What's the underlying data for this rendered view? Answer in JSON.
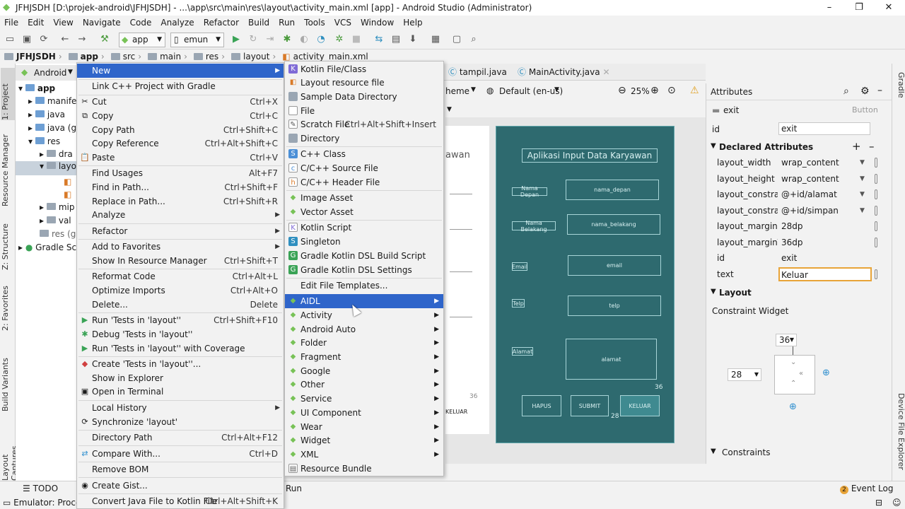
{
  "window": {
    "title": "JFHJSDH [D:\\projek-android\\JFHJSDH] - ...\\app\\src\\main\\res\\layout\\activity_main.xml [app] - Android Studio (Administrator)"
  },
  "menubar": [
    "File",
    "Edit",
    "View",
    "Navigate",
    "Code",
    "Analyze",
    "Refactor",
    "Build",
    "Run",
    "Tools",
    "VCS",
    "Window",
    "Help"
  ],
  "toolbar": {
    "run_config": "app",
    "device": "emun"
  },
  "breadcrumb": [
    "JFHJSDH",
    "app",
    "src",
    "main",
    "res",
    "layout",
    "activity_main.xml"
  ],
  "project": {
    "view": "Android",
    "items": [
      "app",
      "manife",
      "java",
      "java (g",
      "res",
      "dra",
      "layo",
      "mip",
      "val",
      "res (ge",
      "Gradle Scr"
    ]
  },
  "left_tabs": [
    "1: Project",
    "Resource Manager",
    "Z: Structure",
    "2: Favorites",
    "Build Variants",
    "Layout Captures"
  ],
  "context_menu": [
    {
      "label": "New",
      "shortcut": "",
      "submenu": true
    },
    {
      "label": "Link C++ Project with Gradle",
      "shortcut": ""
    },
    {
      "label": "Cut",
      "shortcut": "Ctrl+X"
    },
    {
      "label": "Copy",
      "shortcut": "Ctrl+C"
    },
    {
      "label": "Copy Path",
      "shortcut": "Ctrl+Shift+C"
    },
    {
      "label": "Copy Reference",
      "shortcut": "Ctrl+Alt+Shift+C"
    },
    {
      "label": "Paste",
      "shortcut": "Ctrl+V"
    },
    {
      "label": "Find Usages",
      "shortcut": "Alt+F7"
    },
    {
      "label": "Find in Path...",
      "shortcut": "Ctrl+Shift+F"
    },
    {
      "label": "Replace in Path...",
      "shortcut": "Ctrl+Shift+R"
    },
    {
      "label": "Analyze",
      "shortcut": "",
      "submenu": true
    },
    {
      "label": "Refactor",
      "shortcut": "",
      "submenu": true
    },
    {
      "label": "Add to Favorites",
      "shortcut": "",
      "submenu": true
    },
    {
      "label": "Show In Resource Manager",
      "shortcut": "Ctrl+Shift+T"
    },
    {
      "label": "Reformat Code",
      "shortcut": "Ctrl+Alt+L"
    },
    {
      "label": "Optimize Imports",
      "shortcut": "Ctrl+Alt+O"
    },
    {
      "label": "Delete...",
      "shortcut": "Delete"
    },
    {
      "label": "Run 'Tests in 'layout''",
      "shortcut": "Ctrl+Shift+F10"
    },
    {
      "label": "Debug 'Tests in 'layout''",
      "shortcut": ""
    },
    {
      "label": "Run 'Tests in 'layout'' with Coverage",
      "shortcut": ""
    },
    {
      "label": "Create 'Tests in 'layout''...",
      "shortcut": ""
    },
    {
      "label": "Show in Explorer",
      "shortcut": ""
    },
    {
      "label": "Open in Terminal",
      "shortcut": ""
    },
    {
      "label": "Local History",
      "shortcut": "",
      "submenu": true
    },
    {
      "label": "Synchronize 'layout'",
      "shortcut": ""
    },
    {
      "label": "Directory Path",
      "shortcut": "Ctrl+Alt+F12"
    },
    {
      "label": "Compare With...",
      "shortcut": "Ctrl+D"
    },
    {
      "label": "Remove BOM",
      "shortcut": ""
    },
    {
      "label": "Create Gist...",
      "shortcut": ""
    },
    {
      "label": "Convert Java File to Kotlin File",
      "shortcut": "Ctrl+Alt+Shift+K"
    }
  ],
  "new_submenu": [
    {
      "label": "Kotlin File/Class",
      "shortcut": ""
    },
    {
      "label": "Layout resource file",
      "shortcut": ""
    },
    {
      "label": "Sample Data Directory",
      "shortcut": ""
    },
    {
      "label": "File",
      "shortcut": ""
    },
    {
      "label": "Scratch File",
      "shortcut": "Ctrl+Alt+Shift+Insert"
    },
    {
      "label": "Directory",
      "shortcut": ""
    },
    {
      "label": "C++ Class",
      "shortcut": ""
    },
    {
      "label": "C/C++ Source File",
      "shortcut": ""
    },
    {
      "label": "C/C++ Header File",
      "shortcut": ""
    },
    {
      "label": "Image Asset",
      "shortcut": ""
    },
    {
      "label": "Vector Asset",
      "shortcut": ""
    },
    {
      "label": "Kotlin Script",
      "shortcut": ""
    },
    {
      "label": "Singleton",
      "shortcut": ""
    },
    {
      "label": "Gradle Kotlin DSL Build Script",
      "shortcut": ""
    },
    {
      "label": "Gradle Kotlin DSL Settings",
      "shortcut": ""
    },
    {
      "label": "Edit File Templates...",
      "shortcut": ""
    },
    {
      "label": "AIDL",
      "shortcut": "",
      "submenu": true
    },
    {
      "label": "Activity",
      "shortcut": "",
      "submenu": true
    },
    {
      "label": "Android Auto",
      "shortcut": "",
      "submenu": true
    },
    {
      "label": "Folder",
      "shortcut": "",
      "submenu": true
    },
    {
      "label": "Fragment",
      "shortcut": "",
      "submenu": true
    },
    {
      "label": "Google",
      "shortcut": "",
      "submenu": true
    },
    {
      "label": "Other",
      "shortcut": "",
      "submenu": true
    },
    {
      "label": "Service",
      "shortcut": "",
      "submenu": true
    },
    {
      "label": "UI Component",
      "shortcut": "",
      "submenu": true
    },
    {
      "label": "Wear",
      "shortcut": "",
      "submenu": true
    },
    {
      "label": "Widget",
      "shortcut": "",
      "submenu": true
    },
    {
      "label": "XML",
      "shortcut": "",
      "submenu": true
    },
    {
      "label": "Resource Bundle",
      "shortcut": ""
    }
  ],
  "editor": {
    "tabs": [
      "tampil.java",
      "MainActivity.java"
    ],
    "theme": "heme",
    "locale": "Default (en-us)",
    "zoom": "25%",
    "partial_text": "awan",
    "app_title": "Aplikasi Input Data Karyawan",
    "labels": [
      "Nama Depan",
      "Nama Belakang",
      "Email",
      "Telp",
      "Alamat"
    ],
    "fields": [
      "nama_depan",
      "nama_belakang",
      "email",
      "telp",
      "alamat"
    ],
    "buttons": [
      "HAPUS",
      "SUBMIT",
      "KELUAR"
    ],
    "margin_36": "36",
    "margin_28": "28",
    "keluar_side": "KELUAR"
  },
  "attributes": {
    "header": "Attributes",
    "widget_name": "exit",
    "widget_type": "Button",
    "id_label": "id",
    "id_value": "exit",
    "declared_header": "Declared Attributes",
    "declared": [
      {
        "key": "layout_width",
        "value": "wrap_content"
      },
      {
        "key": "layout_height",
        "value": "wrap_content"
      },
      {
        "key": "layout_constraintT",
        "value": "@+id/alamat"
      },
      {
        "key": "layout_constraintS",
        "value": "@+id/simpan"
      },
      {
        "key": "layout_marginStar",
        "value": "28dp"
      },
      {
        "key": "layout_marginTop",
        "value": "36dp"
      },
      {
        "key": "id",
        "value": "exit"
      },
      {
        "key": "text",
        "value": "Keluar"
      }
    ],
    "layout_header": "Layout",
    "constraint_widget": "Constraint Widget",
    "top_margin": "36",
    "left_margin": "28",
    "constraints_header": "Constraints"
  },
  "right_tabs": [
    "Gradle",
    "Device File Explorer"
  ],
  "statusbar": {
    "todo": "TODO",
    "run": "Run",
    "emulator": "Emulator: Proce",
    "event_log": "Event Log",
    "event_count": "2"
  }
}
